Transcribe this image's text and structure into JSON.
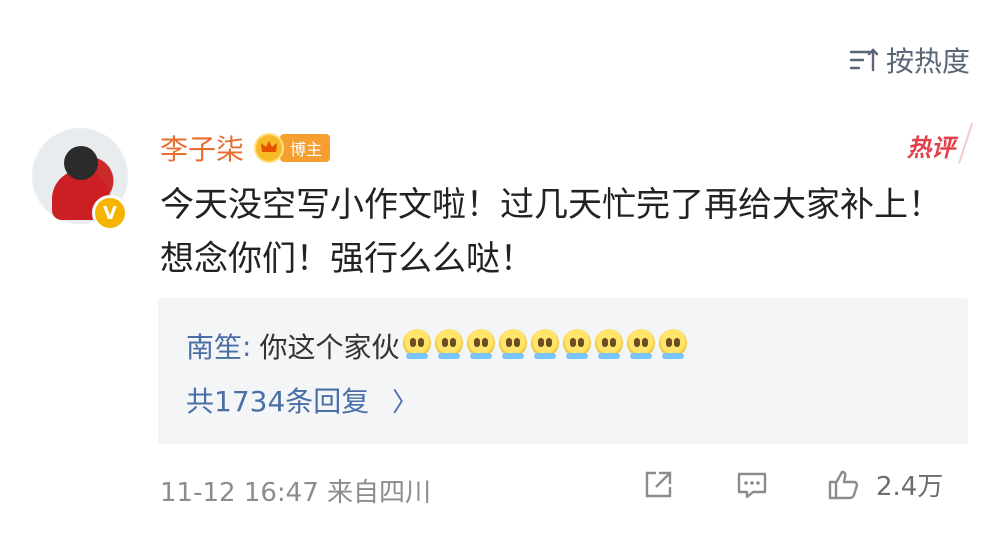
{
  "sort": {
    "label": "按热度",
    "icon": "sort-icon"
  },
  "comment": {
    "username": "李子柒",
    "badge": "博主",
    "hot_tag": "热评",
    "text": "今天没空写小作文啦！过几天忙完了再给大家补上！想念你们！强行么么哒！",
    "reply": {
      "author": "南笙",
      "colon": ":",
      "text": "你这个家伙",
      "emoji": "crying-emoji",
      "emoji_count": 9
    },
    "reply_count_label": "共1734条回复",
    "reply_arrow": "〉",
    "meta": "11-12 16:47  来自四川",
    "likes": "2.4万"
  },
  "colors": {
    "username": "#e86e2f",
    "link": "#4a6ea6",
    "hot": "#e2404b",
    "badge": "#f59f31"
  }
}
